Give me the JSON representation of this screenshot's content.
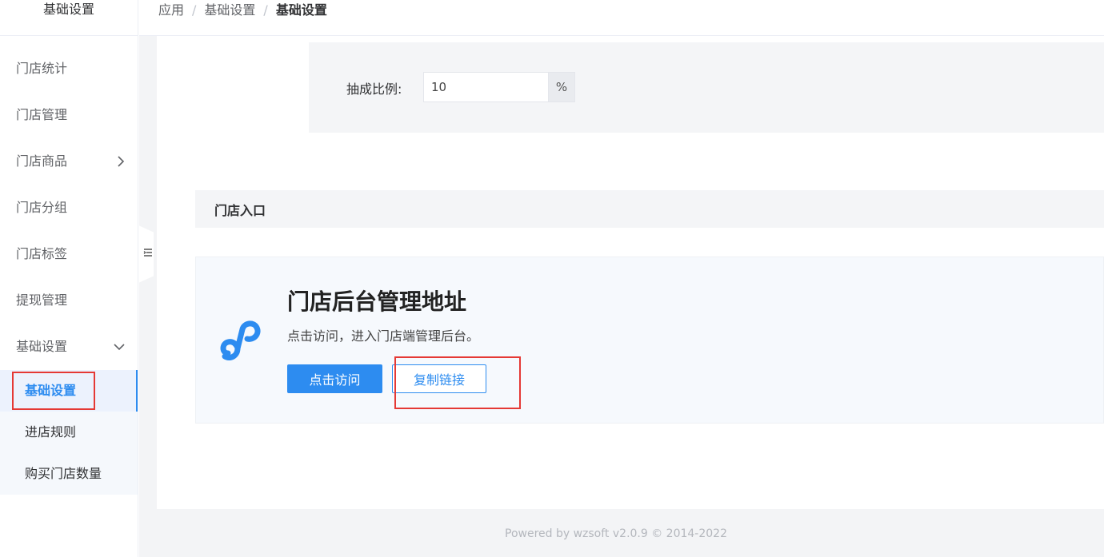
{
  "sidebar": {
    "header": "基础设置",
    "items": [
      {
        "label": "门店统计"
      },
      {
        "label": "门店管理"
      },
      {
        "label": "门店商品",
        "arrow": "›"
      },
      {
        "label": "门店分组"
      },
      {
        "label": "门店标签"
      },
      {
        "label": "提现管理"
      },
      {
        "label": "基础设置",
        "arrow": "⌄"
      }
    ],
    "subitems": [
      {
        "label": "基础设置",
        "active": true
      },
      {
        "label": "进店规则"
      },
      {
        "label": "购买门店数量"
      }
    ]
  },
  "breadcrumb": {
    "items": [
      "应用",
      "基础设置"
    ],
    "separator": "/",
    "current": "基础设置"
  },
  "commission": {
    "label": "抽成比例:",
    "value": "10",
    "suffix": "%"
  },
  "section": {
    "title": "门店入口"
  },
  "entry": {
    "title": "门店后台管理地址",
    "description": "点击访问，进入门店端管理后台。",
    "visit_label": "点击访问",
    "copy_label": "复制链接"
  },
  "footer": {
    "text": "Powered by wzsoft v2.0.9 © 2014-2022"
  },
  "colors": {
    "primary": "#2d8cf0",
    "highlight_box": "#e53935"
  }
}
